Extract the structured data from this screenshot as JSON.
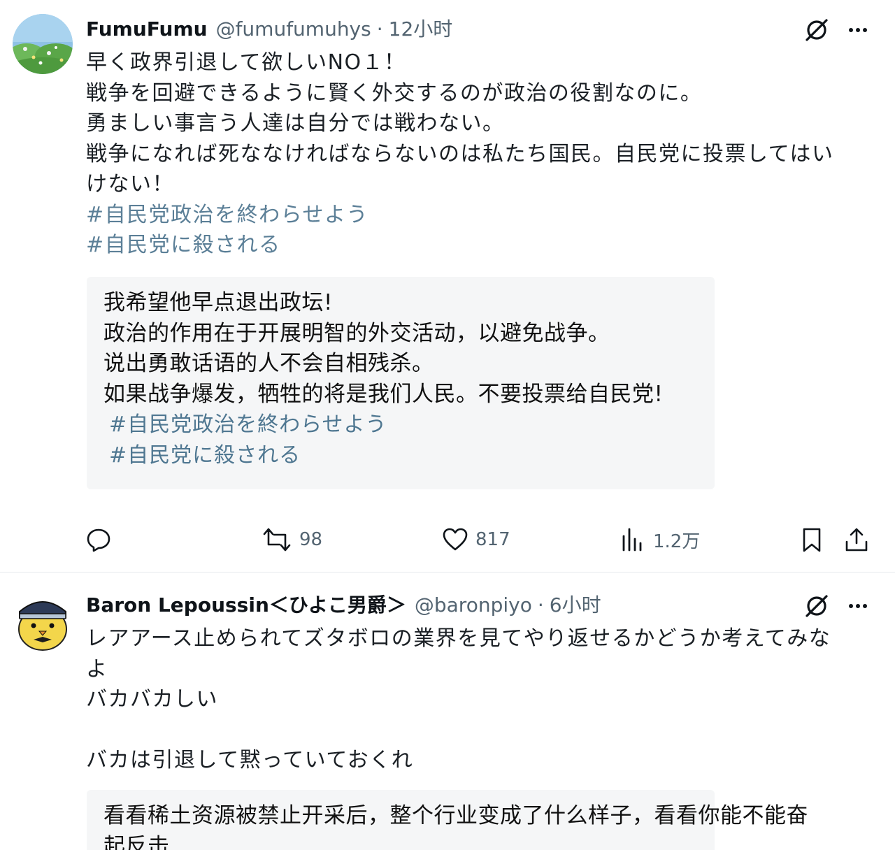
{
  "posts": [
    {
      "user": {
        "display_name": "FumuFumu",
        "handle": "@fumufumuhys",
        "time": "12小时"
      },
      "text_lines": [
        "早く政界引退して欲しいNO１！",
        "戦争を回避できるように賢く外交するのが政治の役割なのに。",
        "勇ましい事言う人達は自分では戦わない。",
        "戦争になれば死ななければならないのは私たち国民。自民党に投票してはい",
        "けない！"
      ],
      "hashtags": [
        "#自民党政治を終わらせよう",
        "#自民党に殺される"
      ],
      "translation": {
        "lines": [
          "我希望他早点退出政坛!",
          "政治的作用在于开展明智的外交活动，以避免战争。",
          "说出勇敢话语的人不会自相残杀。",
          "如果战争爆发，牺牲的将是我们人民。不要投票给自民党!"
        ],
        "hashtags": [
          "#自民党政治を終わらせよう",
          "#自民党に殺される"
        ]
      },
      "actions": {
        "reply_icon": "reply-icon",
        "retweets": "98",
        "likes": "817",
        "views": "1.2万",
        "bookmark_icon": "bookmark-icon",
        "share_icon": "share-icon"
      }
    },
    {
      "user": {
        "display_name": "Baron Lepoussin＜ひよこ男爵＞",
        "handle": "@baronpiyo",
        "time": "6小时"
      },
      "text_lines": [
        "レアアース止められてズタボロの業界を見てやり返せるかどうか考えてみな",
        "よ",
        "バカバカしい",
        "",
        "バカは引退して黙っていておくれ"
      ],
      "translation": {
        "lines": [
          "看看稀土资源被禁止开采后，整个行业变成了什么样子，看看你能不能奋",
          "起反击"
        ]
      }
    }
  ],
  "colors": {
    "text": "#0f1419",
    "muted": "#536471",
    "hashtag": "#5b7f97",
    "translation_bg": "#f5f6f7"
  }
}
